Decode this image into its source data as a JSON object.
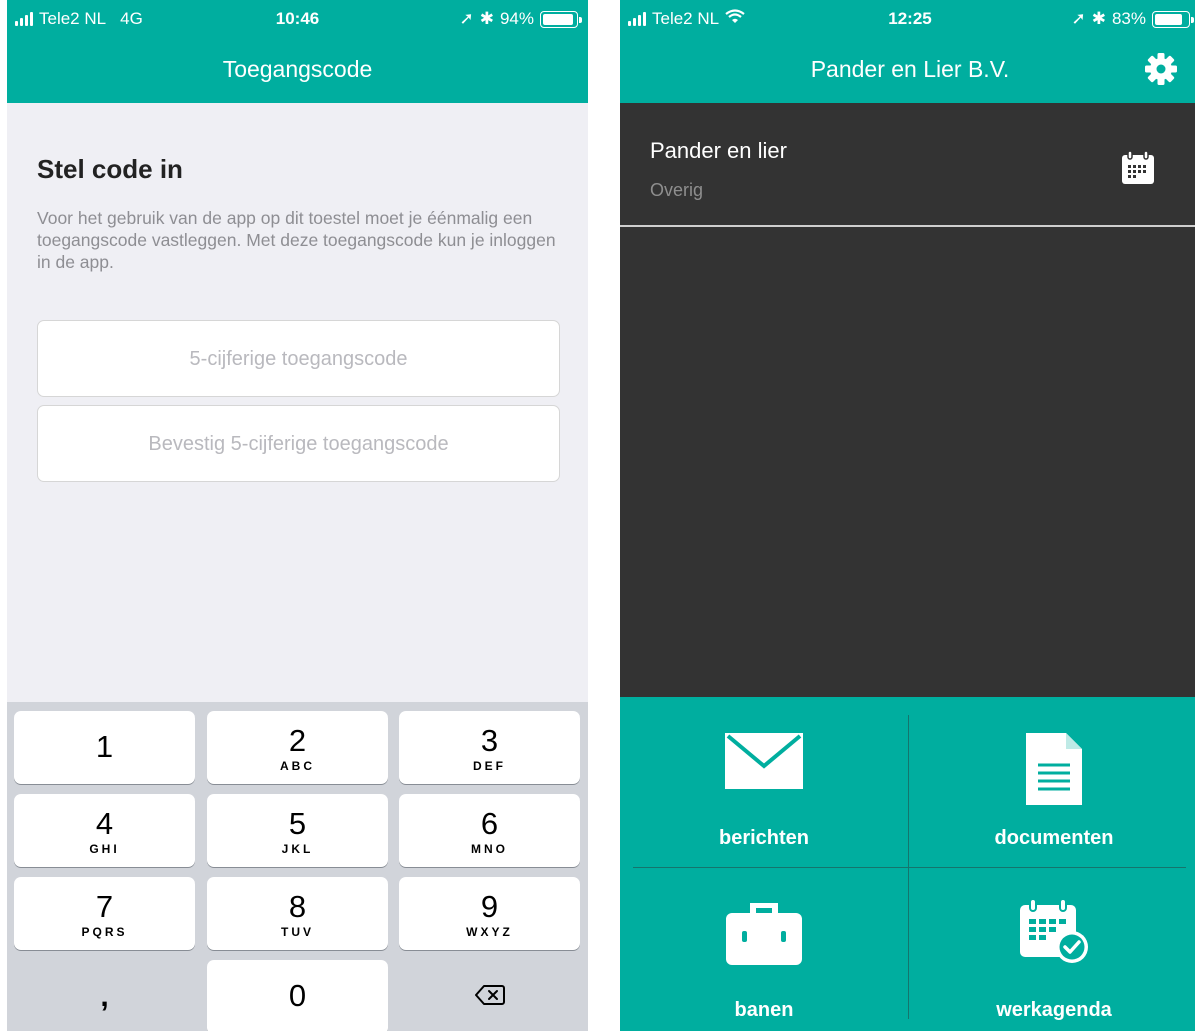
{
  "screen1": {
    "status": {
      "carrier": "Tele2 NL",
      "network": "4G",
      "time": "10:46",
      "battery": "94%",
      "battery_level": 0.94
    },
    "nav_title": "Toegangscode",
    "heading": "Stel code in",
    "description": "Voor het gebruik van de app op dit toestel moet je éénmalig een toegangscode vastleggen. Met deze toegangscode kun je inloggen in de app.",
    "fields": {
      "code_placeholder": "5-cijferige toegangscode",
      "confirm_placeholder": "Bevestig 5-cijferige toegangscode"
    },
    "keypad": {
      "keys": [
        {
          "num": "1",
          "letters": ""
        },
        {
          "num": "2",
          "letters": "ABC"
        },
        {
          "num": "3",
          "letters": "DEF"
        },
        {
          "num": "4",
          "letters": "GHI"
        },
        {
          "num": "5",
          "letters": "JKL"
        },
        {
          "num": "6",
          "letters": "MNO"
        },
        {
          "num": "7",
          "letters": "PQRS"
        },
        {
          "num": "8",
          "letters": "TUV"
        },
        {
          "num": "9",
          "letters": "WXYZ"
        }
      ],
      "comma": ",",
      "zero": "0"
    }
  },
  "screen2": {
    "status": {
      "carrier": "Tele2 NL",
      "time": "12:25",
      "battery": "83%",
      "battery_level": 0.83
    },
    "nav_title": "Pander en Lier B.V.",
    "item": {
      "title": "Pander en lier",
      "subtitle": "Overig"
    },
    "tiles": {
      "berichten": "berichten",
      "documenten": "documenten",
      "banen": "banen",
      "werkagenda": "werkagenda"
    }
  },
  "colors": {
    "brand": "#00ae9f",
    "dark_bg": "#333333",
    "keypad_bg": "#d1d4da"
  }
}
